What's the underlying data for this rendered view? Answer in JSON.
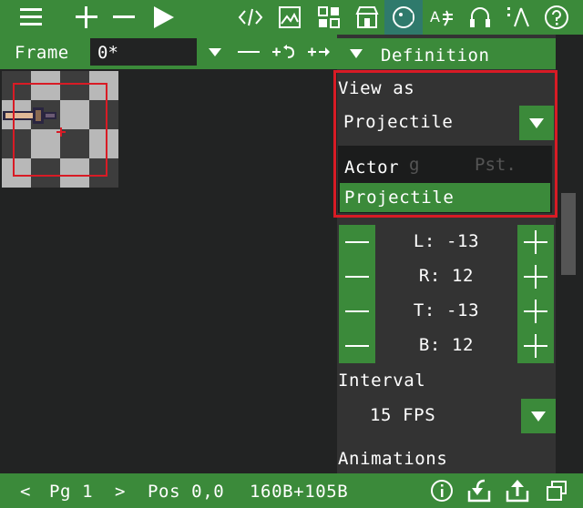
{
  "toolbar": {
    "icons": [
      "menu-icon",
      "add-icon",
      "remove-icon",
      "play-icon",
      "code-icon",
      "image-icon",
      "tiles-icon",
      "store-icon",
      "actor-icon",
      "text-icon",
      "audio-icon",
      "map-icon",
      "help-icon"
    ],
    "active": "actor-icon"
  },
  "frame_bar": {
    "label": "Frame",
    "value": "0*",
    "buttons": [
      "dropdown-icon",
      "minus-icon",
      "add-before-icon",
      "add-after-icon"
    ]
  },
  "panel": {
    "header": "Definition",
    "view_as_label": "View as",
    "view_as_value": "Projectile",
    "dropdown": {
      "options": [
        "Actor",
        "Projectile"
      ],
      "selected": "Projectile"
    },
    "hidden_behind": [
      "g",
      "Pst."
    ],
    "bounds": [
      {
        "label": "L: -13"
      },
      {
        "label": "R: 12"
      },
      {
        "label": "T: -13"
      },
      {
        "label": "B: 12"
      }
    ],
    "interval_label": "Interval",
    "interval_value": "15 FPS",
    "animations_label": "Animations"
  },
  "status": {
    "prev": "<",
    "page": "Pg 1",
    "next": ">",
    "pos": "Pos 0,0",
    "size": "160B+105B",
    "icons": [
      "info-icon",
      "import-icon",
      "export-icon",
      "window-icon"
    ]
  },
  "colors": {
    "accent": "#3b8a3a",
    "background": "#222323",
    "panel": "#333333",
    "highlight": "#d81b25",
    "active_tool": "#2f7a6c"
  }
}
